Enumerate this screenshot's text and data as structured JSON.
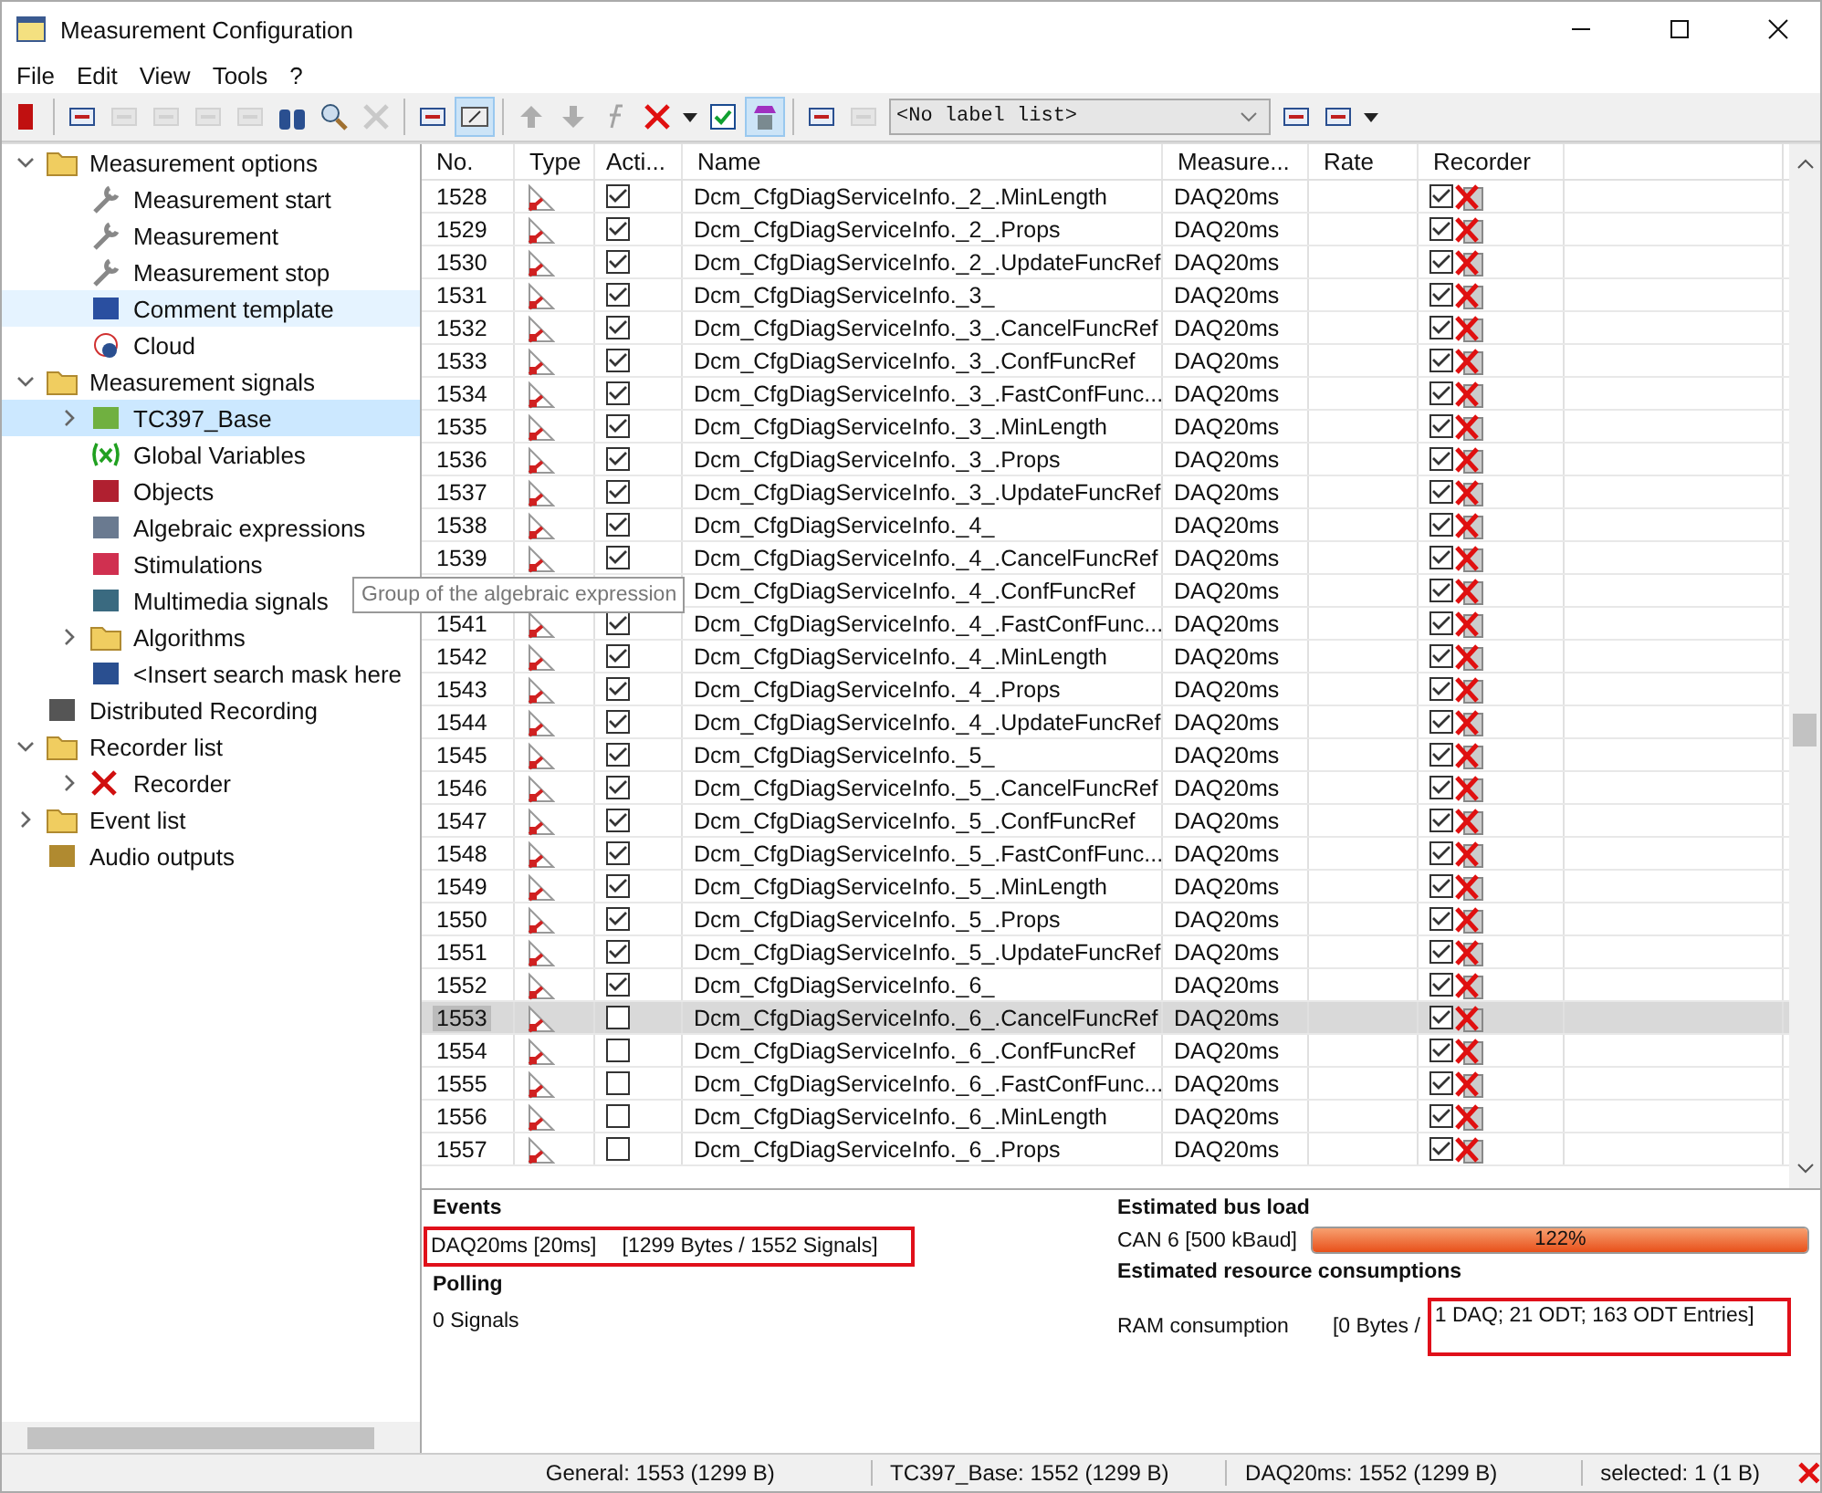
{
  "window": {
    "title": "Measurement Configuration"
  },
  "menu": [
    "File",
    "Edit",
    "View",
    "Tools",
    "?"
  ],
  "toolbar": {
    "buttons": [
      {
        "kind": "button",
        "disabled": false,
        "pressed": false
      },
      {
        "kind": "separator"
      },
      {
        "kind": "button",
        "disabled": false,
        "pressed": false
      },
      {
        "kind": "button",
        "disabled": true,
        "pressed": false
      },
      {
        "kind": "button",
        "disabled": true,
        "pressed": false
      },
      {
        "kind": "button",
        "disabled": true,
        "pressed": false
      },
      {
        "kind": "button",
        "disabled": true,
        "pressed": false
      },
      {
        "kind": "button",
        "disabled": false,
        "pressed": false
      },
      {
        "kind": "button",
        "disabled": false,
        "pressed": false
      },
      {
        "kind": "button",
        "disabled": true,
        "pressed": false
      },
      {
        "kind": "separator"
      },
      {
        "kind": "button",
        "disabled": false,
        "pressed": false
      },
      {
        "kind": "button",
        "disabled": false,
        "pressed": true
      },
      {
        "kind": "separator"
      },
      {
        "kind": "button",
        "disabled": true,
        "pressed": false
      },
      {
        "kind": "button",
        "disabled": true,
        "pressed": false
      },
      {
        "kind": "button",
        "disabled": true,
        "pressed": false
      },
      {
        "kind": "button",
        "disabled": false,
        "pressed": false
      },
      {
        "kind": "dropdown",
        "disabled": false,
        "pressed": false
      },
      {
        "kind": "button",
        "disabled": false,
        "pressed": false
      },
      {
        "kind": "button",
        "disabled": false,
        "pressed": true
      },
      {
        "kind": "separator"
      },
      {
        "kind": "button",
        "disabled": false,
        "pressed": false
      },
      {
        "kind": "button",
        "disabled": true,
        "pressed": false
      },
      {
        "kind": "combo",
        "value": "<No label list>"
      },
      {
        "kind": "button",
        "disabled": false,
        "pressed": false
      },
      {
        "kind": "button",
        "disabled": false,
        "pressed": false
      },
      {
        "kind": "dropdown",
        "disabled": false,
        "pressed": false
      }
    ]
  },
  "tree": [
    {
      "label": "Measurement options",
      "expanded": true,
      "selected": false,
      "children": [
        {
          "label": "Measurement start",
          "selected": false
        },
        {
          "label": "Measurement",
          "selected": false
        },
        {
          "label": "Measurement stop",
          "selected": false
        },
        {
          "label": "Comment template",
          "selected": false,
          "hovered": true
        },
        {
          "label": "Cloud",
          "selected": false
        }
      ]
    },
    {
      "label": "Measurement signals",
      "expanded": true,
      "selected": false,
      "children": [
        {
          "label": "TC397_Base",
          "expanded": false,
          "selected": true
        },
        {
          "label": "Global Variables",
          "selected": false
        },
        {
          "label": "Objects",
          "selected": false
        },
        {
          "label": "Algebraic expressions",
          "selected": false
        },
        {
          "label": "Stimulations",
          "selected": false
        },
        {
          "label": "Multimedia signals",
          "selected": false
        },
        {
          "label": "Algorithms",
          "expanded": false,
          "selected": false
        },
        {
          "label": "<Insert search mask here",
          "selected": false
        }
      ]
    },
    {
      "label": "Distributed Recording",
      "selected": false
    },
    {
      "label": "Recorder list",
      "expanded": true,
      "selected": false,
      "children": [
        {
          "label": "Recorder",
          "expanded": false,
          "selected": false
        }
      ]
    },
    {
      "label": "Event list",
      "expanded": false,
      "selected": false
    },
    {
      "label": "Audio outputs",
      "selected": false
    }
  ],
  "tooltip": "Group of the algebraic expression",
  "table": {
    "columns": [
      "No.",
      "Type",
      "Acti...",
      "Name",
      "Measure...",
      "Rate",
      "Recorder"
    ],
    "rows": [
      {
        "no": "1528",
        "active": true,
        "name": "Dcm_CfgDiagServiceInfo._2_.MinLength",
        "measure": "DAQ20ms",
        "recorder": true,
        "selected": false
      },
      {
        "no": "1529",
        "active": true,
        "name": "Dcm_CfgDiagServiceInfo._2_.Props",
        "measure": "DAQ20ms",
        "recorder": true,
        "selected": false
      },
      {
        "no": "1530",
        "active": true,
        "name": "Dcm_CfgDiagServiceInfo._2_.UpdateFuncRef",
        "measure": "DAQ20ms",
        "recorder": true,
        "selected": false
      },
      {
        "no": "1531",
        "active": true,
        "name": "Dcm_CfgDiagServiceInfo._3_",
        "measure": "DAQ20ms",
        "recorder": true,
        "selected": false
      },
      {
        "no": "1532",
        "active": true,
        "name": "Dcm_CfgDiagServiceInfo._3_.CancelFuncRef",
        "measure": "DAQ20ms",
        "recorder": true,
        "selected": false
      },
      {
        "no": "1533",
        "active": true,
        "name": "Dcm_CfgDiagServiceInfo._3_.ConfFuncRef",
        "measure": "DAQ20ms",
        "recorder": true,
        "selected": false
      },
      {
        "no": "1534",
        "active": true,
        "name": "Dcm_CfgDiagServiceInfo._3_.FastConfFunc...",
        "measure": "DAQ20ms",
        "recorder": true,
        "selected": false
      },
      {
        "no": "1535",
        "active": true,
        "name": "Dcm_CfgDiagServiceInfo._3_.MinLength",
        "measure": "DAQ20ms",
        "recorder": true,
        "selected": false
      },
      {
        "no": "1536",
        "active": true,
        "name": "Dcm_CfgDiagServiceInfo._3_.Props",
        "measure": "DAQ20ms",
        "recorder": true,
        "selected": false
      },
      {
        "no": "1537",
        "active": true,
        "name": "Dcm_CfgDiagServiceInfo._3_.UpdateFuncRef",
        "measure": "DAQ20ms",
        "recorder": true,
        "selected": false
      },
      {
        "no": "1538",
        "active": true,
        "name": "Dcm_CfgDiagServiceInfo._4_",
        "measure": "DAQ20ms",
        "recorder": true,
        "selected": false
      },
      {
        "no": "1539",
        "active": true,
        "name": "Dcm_CfgDiagServiceInfo._4_.CancelFuncRef",
        "measure": "DAQ20ms",
        "recorder": true,
        "selected": false
      },
      {
        "name": "Dcm_CfgDiagServiceInfo._4_.ConfFuncRef",
        "measure": "DAQ20ms",
        "recorder": true,
        "selected": false
      },
      {
        "no": "1541",
        "active": true,
        "name": "Dcm_CfgDiagServiceInfo._4_.FastConfFunc...",
        "measure": "DAQ20ms",
        "recorder": true,
        "selected": false
      },
      {
        "no": "1542",
        "active": true,
        "name": "Dcm_CfgDiagServiceInfo._4_.MinLength",
        "measure": "DAQ20ms",
        "recorder": true,
        "selected": false
      },
      {
        "no": "1543",
        "active": true,
        "name": "Dcm_CfgDiagServiceInfo._4_.Props",
        "measure": "DAQ20ms",
        "recorder": true,
        "selected": false
      },
      {
        "no": "1544",
        "active": true,
        "name": "Dcm_CfgDiagServiceInfo._4_.UpdateFuncRef",
        "measure": "DAQ20ms",
        "recorder": true,
        "selected": false
      },
      {
        "no": "1545",
        "active": true,
        "name": "Dcm_CfgDiagServiceInfo._5_",
        "measure": "DAQ20ms",
        "recorder": true,
        "selected": false
      },
      {
        "no": "1546",
        "active": true,
        "name": "Dcm_CfgDiagServiceInfo._5_.CancelFuncRef",
        "measure": "DAQ20ms",
        "recorder": true,
        "selected": false
      },
      {
        "no": "1547",
        "active": true,
        "name": "Dcm_CfgDiagServiceInfo._5_.ConfFuncRef",
        "measure": "DAQ20ms",
        "recorder": true,
        "selected": false
      },
      {
        "no": "1548",
        "active": true,
        "name": "Dcm_CfgDiagServiceInfo._5_.FastConfFunc...",
        "measure": "DAQ20ms",
        "recorder": true,
        "selected": false
      },
      {
        "no": "1549",
        "active": true,
        "name": "Dcm_CfgDiagServiceInfo._5_.MinLength",
        "measure": "DAQ20ms",
        "recorder": true,
        "selected": false
      },
      {
        "no": "1550",
        "active": true,
        "name": "Dcm_CfgDiagServiceInfo._5_.Props",
        "measure": "DAQ20ms",
        "recorder": true,
        "selected": false
      },
      {
        "no": "1551",
        "active": true,
        "name": "Dcm_CfgDiagServiceInfo._5_.UpdateFuncRef",
        "measure": "DAQ20ms",
        "recorder": true,
        "selected": false
      },
      {
        "no": "1552",
        "active": true,
        "name": "Dcm_CfgDiagServiceInfo._6_",
        "measure": "DAQ20ms",
        "recorder": true,
        "selected": false
      },
      {
        "no": "1553",
        "active": false,
        "name": "Dcm_CfgDiagServiceInfo._6_.CancelFuncRef",
        "measure": "DAQ20ms",
        "recorder": true,
        "selected": true
      },
      {
        "no": "1554",
        "active": false,
        "name": "Dcm_CfgDiagServiceInfo._6_.ConfFuncRef",
        "measure": "DAQ20ms",
        "recorder": true,
        "selected": false
      },
      {
        "no": "1555",
        "active": false,
        "name": "Dcm_CfgDiagServiceInfo._6_.FastConfFunc...",
        "measure": "DAQ20ms",
        "recorder": true,
        "selected": false
      },
      {
        "no": "1556",
        "active": false,
        "name": "Dcm_CfgDiagServiceInfo._6_.MinLength",
        "measure": "DAQ20ms",
        "recorder": true,
        "selected": false
      },
      {
        "no": "1557",
        "active": false,
        "name": "Dcm_CfgDiagServiceInfo._6_.Props",
        "measure": "DAQ20ms",
        "recorder": true,
        "selected": false
      }
    ]
  },
  "summary": {
    "events": {
      "title": "Events",
      "entries": [
        {
          "name": "DAQ20ms [20ms]",
          "detail": "[1299 Bytes / 1552 Signals]",
          "framed": true
        }
      ]
    },
    "polling": {
      "title": "Polling",
      "text": "0 Signals"
    },
    "bus_load": {
      "title": "Estimated bus load",
      "label": "CAN 6 [500 kBaud]",
      "level": 1,
      "reading": "122%"
    },
    "resources": {
      "title": "Estimated resource consumptions",
      "label": "RAM consumption",
      "value_1": "[0 Bytes /",
      "value_2": "1 DAQ; 21 ODT; 163 ODT Entries]",
      "value_2_framed": true
    }
  },
  "status_bar": [
    "General:  1553 (1299 B)",
    "TC397_Base: 1552 (1299 B)",
    "DAQ20ms: 1552 (1299 B)",
    "selected: 1 (1 B)"
  ]
}
